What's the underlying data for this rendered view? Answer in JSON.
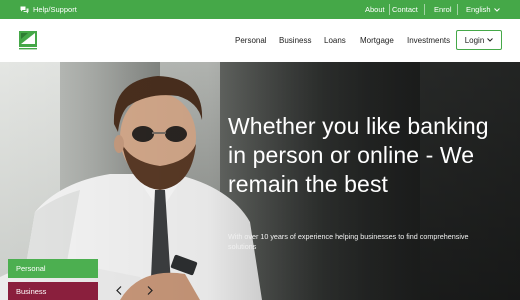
{
  "topbar": {
    "help_label": "Help/Support",
    "about_label": "About",
    "contact_label": "Contact",
    "enrol_label": "Enrol",
    "language_label": "English"
  },
  "nav": {
    "items": [
      "Personal",
      "Business",
      "Loans",
      "Mortgage",
      "Investments"
    ],
    "login_label": "Login"
  },
  "hero": {
    "title": "Whether you like banking in person or online - We remain the best",
    "subtitle": "With over 10 years of experience helping businesses to find comprehensive solutions"
  },
  "tabs": {
    "personal": "Personal",
    "business": "Business"
  },
  "colors": {
    "brand_green": "#45a848",
    "tab_green": "#4caf50",
    "tab_maroon": "#8a1f3d"
  },
  "icons": {
    "help": "chat-bubbles-icon",
    "language": "chevron-down-icon",
    "login": "chevron-down-icon",
    "prev": "chevron-left-icon",
    "next": "chevron-right-icon"
  }
}
